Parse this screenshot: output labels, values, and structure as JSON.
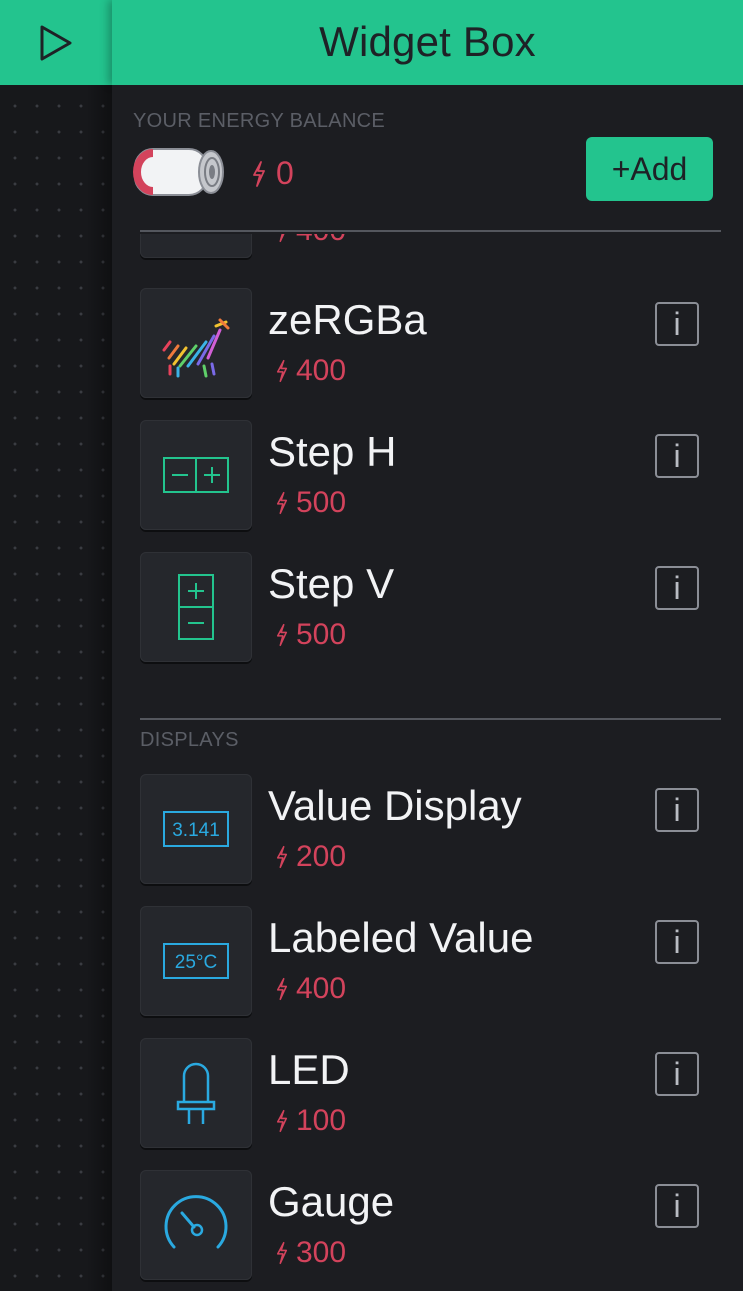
{
  "header": {
    "title": "Widget Box",
    "play_icon": "play-icon"
  },
  "energy": {
    "label": "YOUR ENERGY BALANCE",
    "balance": "0",
    "battery_icon": "battery-icon",
    "bolt_icon": "bolt-icon",
    "add_label": "+Add"
  },
  "widgets_top": [
    {
      "name": "",
      "cost": "400",
      "icon": "partial-widget-icon"
    },
    {
      "name": "zeRGBa",
      "cost": "400",
      "icon": "zebra-icon"
    },
    {
      "name": "Step H",
      "cost": "500",
      "icon": "step-h-icon"
    },
    {
      "name": "Step V",
      "cost": "500",
      "icon": "step-v-icon"
    }
  ],
  "displays": {
    "label": "DISPLAYS",
    "items": [
      {
        "name": "Value Display",
        "cost": "200",
        "icon": "value-display-icon",
        "icon_text": "3.141"
      },
      {
        "name": "Labeled Value",
        "cost": "400",
        "icon": "labeled-value-icon",
        "icon_text": "25°C"
      },
      {
        "name": "LED",
        "cost": "100",
        "icon": "led-icon"
      },
      {
        "name": "Gauge",
        "cost": "300",
        "icon": "gauge-icon"
      }
    ]
  },
  "info_label": "i",
  "colors": {
    "accent": "#23c48e",
    "energy": "#d3435c",
    "display_icon": "#2aa9e0",
    "background": "#1c1d21"
  }
}
